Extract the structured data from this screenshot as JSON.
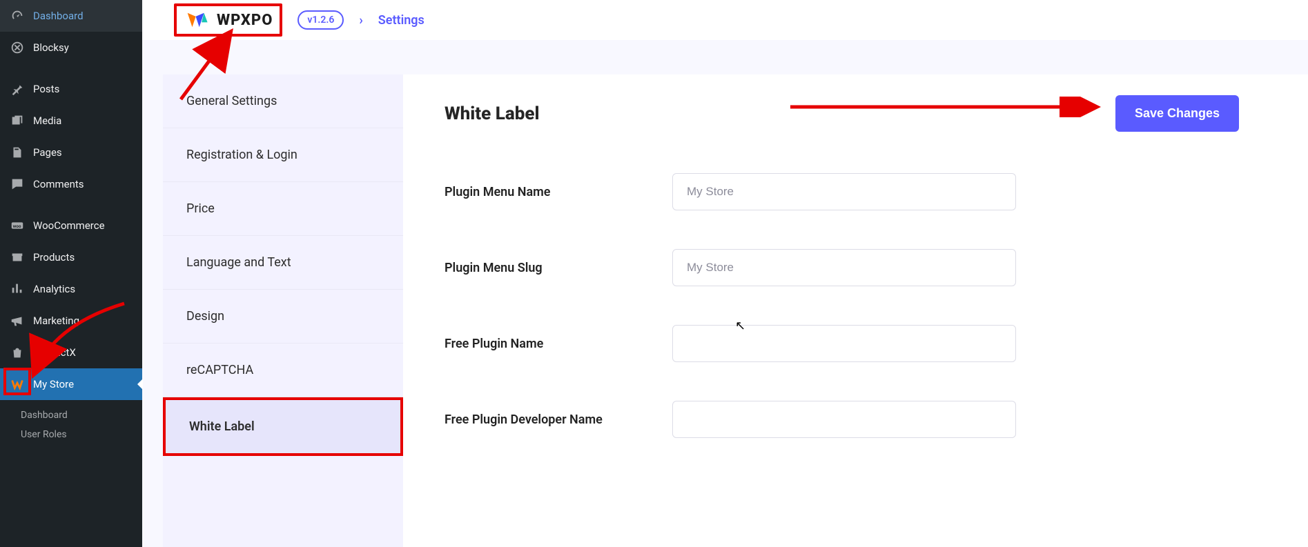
{
  "wp_sidebar": {
    "items": [
      {
        "label": "Dashboard",
        "icon": "gauge"
      },
      {
        "label": "Blocksy",
        "icon": "circle-logo"
      },
      {
        "label": "Posts",
        "icon": "pin"
      },
      {
        "label": "Media",
        "icon": "media"
      },
      {
        "label": "Pages",
        "icon": "pages"
      },
      {
        "label": "Comments",
        "icon": "comment"
      },
      {
        "label": "WooCommerce",
        "icon": "woo"
      },
      {
        "label": "Products",
        "icon": "archive"
      },
      {
        "label": "Analytics",
        "icon": "bars"
      },
      {
        "label": "Marketing",
        "icon": "megaphone"
      },
      {
        "label": "ProductX",
        "icon": "bag"
      },
      {
        "label": "My Store",
        "icon": "wpxpo-mini"
      }
    ],
    "sub": [
      {
        "label": "Dashboard"
      },
      {
        "label": "User Roles"
      }
    ]
  },
  "header": {
    "brand": "WPXPO",
    "version": "v1.2.6",
    "crumb": "Settings"
  },
  "tabs": [
    {
      "label": "General Settings"
    },
    {
      "label": "Registration & Login"
    },
    {
      "label": "Price"
    },
    {
      "label": "Language and Text"
    },
    {
      "label": "Design"
    },
    {
      "label": "reCAPTCHA"
    },
    {
      "label": "White Label"
    }
  ],
  "panel": {
    "title": "White Label",
    "save_label": "Save Changes",
    "fields": [
      {
        "label": "Plugin Menu Name",
        "placeholder": "My Store",
        "value": ""
      },
      {
        "label": "Plugin Menu Slug",
        "placeholder": "My Store",
        "value": ""
      },
      {
        "label": "Free Plugin Name",
        "placeholder": "",
        "value": ""
      },
      {
        "label": "Free Plugin Developer Name",
        "placeholder": "",
        "value": ""
      }
    ]
  },
  "colors": {
    "accent": "#5a5bff",
    "annotation": "#e60000"
  }
}
